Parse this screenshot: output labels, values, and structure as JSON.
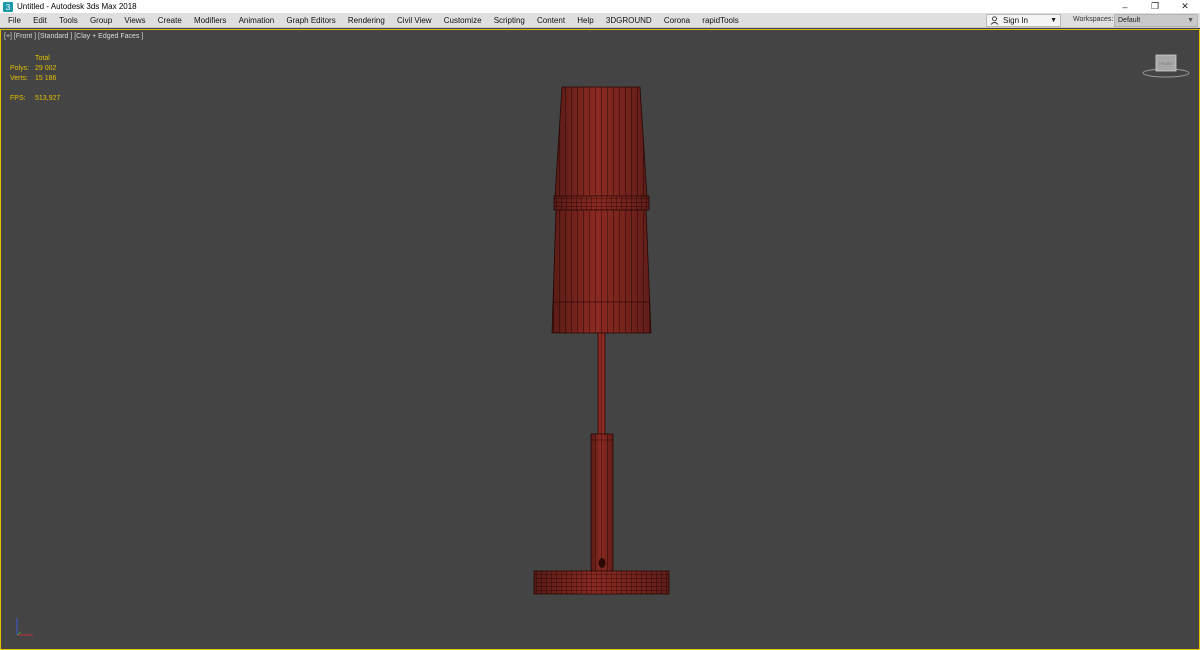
{
  "window": {
    "title": "Untitled - Autodesk 3ds Max 2018",
    "controls": {
      "minimize": "–",
      "restore": "❐",
      "close": "✕"
    }
  },
  "menu": {
    "items": [
      "File",
      "Edit",
      "Tools",
      "Group",
      "Views",
      "Create",
      "Modifiers",
      "Animation",
      "Graph Editors",
      "Rendering",
      "Civil View",
      "Customize",
      "Scripting",
      "Content",
      "Help",
      "3DGROUND",
      "Corona",
      "rapidTools"
    ],
    "signin_label": "Sign In",
    "workspaces_label": "Workspaces:",
    "workspaces_value": "Default"
  },
  "viewport": {
    "label": "[+] [Front ] [Standard ] [Clay + Edged Faces ]",
    "stats": {
      "header": "Total",
      "polys_label": "Polys:",
      "polys_value": "29 002",
      "verts_label": "Verts:",
      "verts_value": "15 186",
      "fps_label": "FPS:",
      "fps_value": "513,927"
    },
    "viewcube_face": "FRONT",
    "model_color": "#8b2a22",
    "accent_color": "#e3c100"
  },
  "icons": {
    "app": "3dsmax-app-icon",
    "user": "user-icon",
    "axis": "axis-gizmo-icon"
  }
}
